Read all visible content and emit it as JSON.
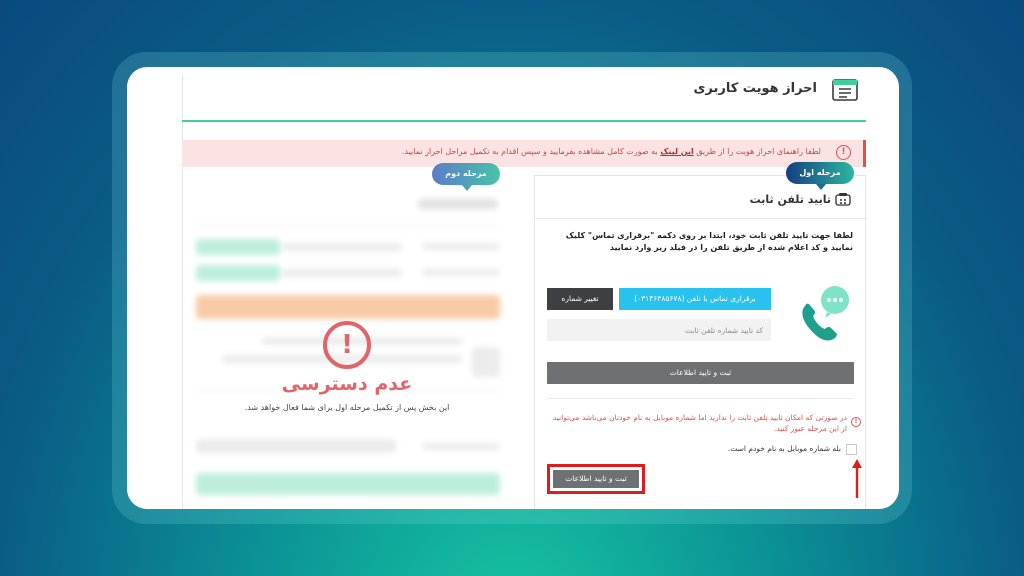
{
  "header": {
    "title": "احراز هویت کاربری",
    "icon": "id-card-icon"
  },
  "alert": {
    "text_before": "لطفا راهنمای احراز هویت را از طریق",
    "link_text": "این لینک",
    "text_after": "به صورت کامل مشاهده بفرمایید و سپس اقدام به تکمیل مراحل احراز نمایید.",
    "icon": "alert-circle-icon"
  },
  "stage2": {
    "badge": "مرحله دوم",
    "denied_title": "عدم دسترسی",
    "denied_subtitle": "این بخش پس از تکمیل مرحله اول برای شما فعال خواهد شد.",
    "icon": "exclamation-circle-icon"
  },
  "stage1": {
    "badge": "مرحله اول",
    "title": "تایید تلفن ثابت",
    "description": "لطفا جهت تایید تلفن ثابت خود، ابتدا بر روی دکمه \"برقراری تماس\" کلیک نمایید و کد اعلام شده از طریق تلفن را در فیلد زیر وارد نمایید",
    "change_number_label": "تغییر شماره",
    "call_button_label": "برقراری تماس با تلفن (۰۳۱۴۶۳۸۵۶۷۸)",
    "code_placeholder": "کد تایید شماره تلفن ثابت",
    "submit_label": "ثبت و تایید اطلاعات",
    "note": "در صورتی که امکان تایید تلفن ثابت را ندارید اما شماره موبایل به نام خودتان می‌باشد می‌توانید از این مرحله عبور کنید.",
    "checkbox_label": "بله شماره موبایل به نام خودم است.",
    "checkbox_checked": false,
    "submit2_label": "ثبت و تایید اطلاعات"
  },
  "colors": {
    "accent_green": "#3fcf9c",
    "call_button": "#29c1ee",
    "danger": "#d9534f",
    "highlight_red": "#e01d1d"
  }
}
